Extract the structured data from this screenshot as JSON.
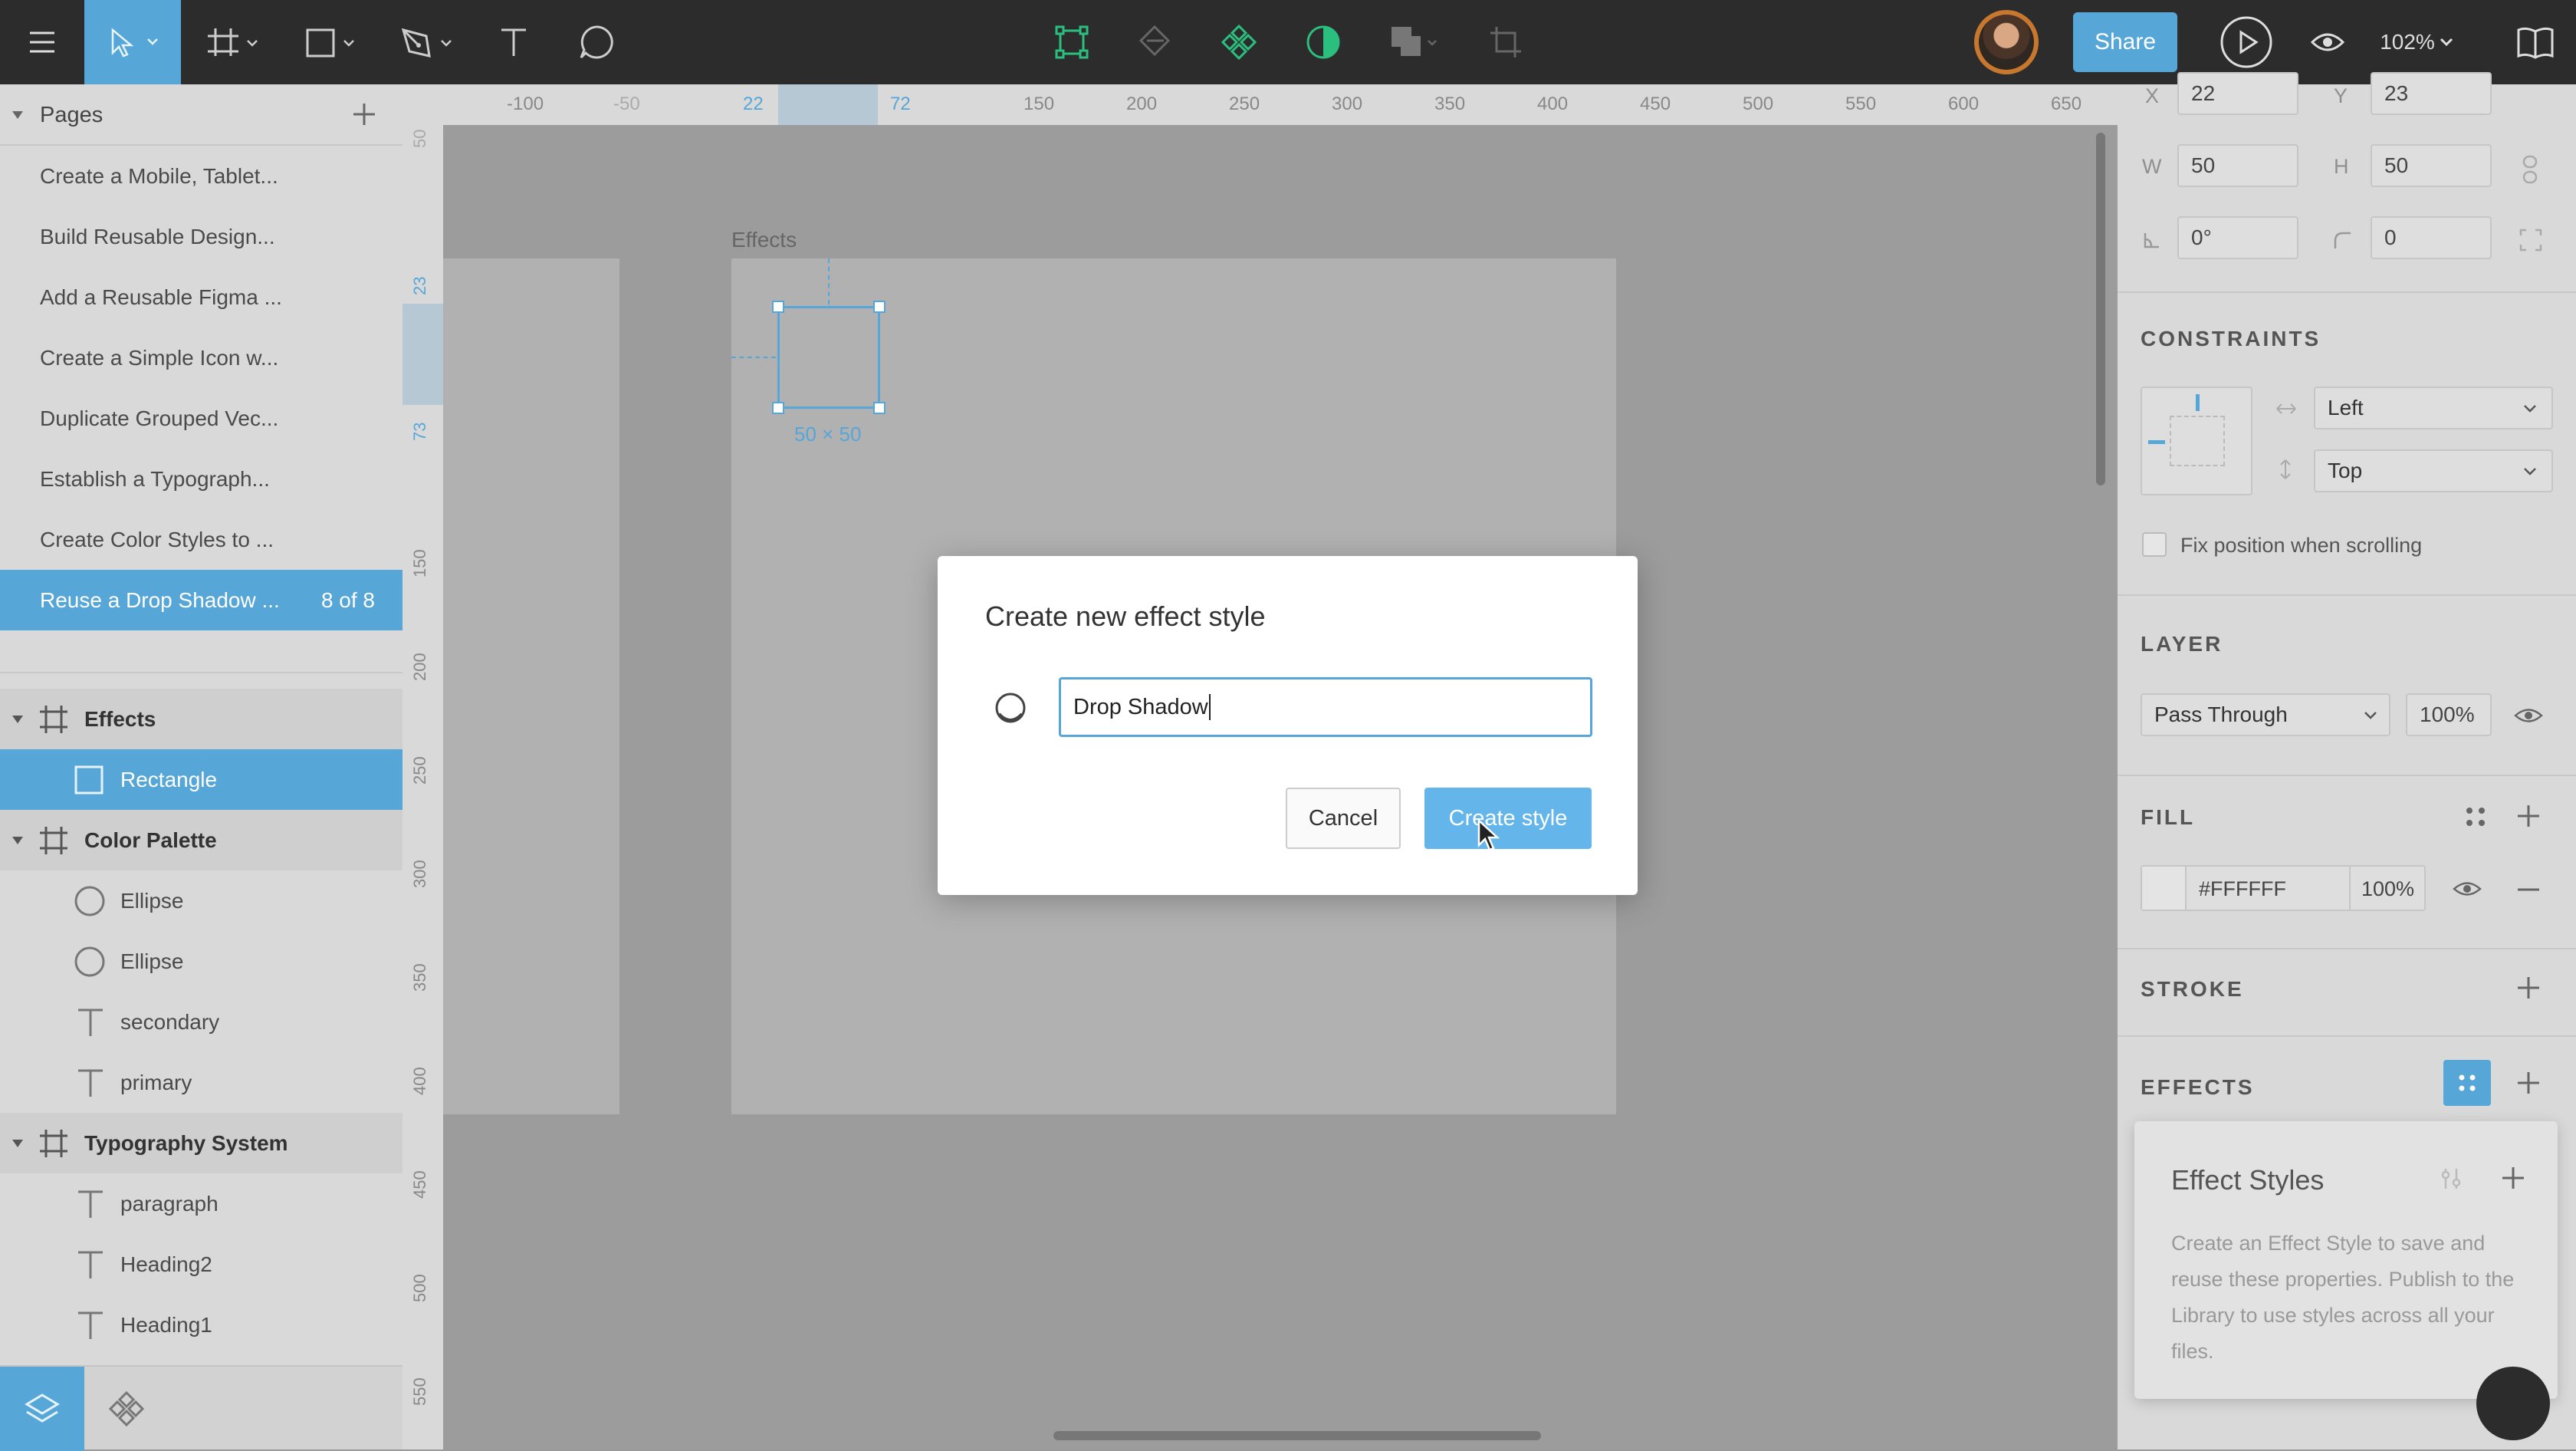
{
  "toolbar": {
    "share_label": "Share",
    "zoom": "102%",
    "icons": [
      "menu-icon",
      "move-icon",
      "frame-icon",
      "shape-icon",
      "pen-icon",
      "text-icon",
      "comment-icon",
      "component-icon",
      "boolean-icon",
      "mask-icon",
      "contrast-icon",
      "layers-boolean-icon",
      "crop-icon",
      "play-icon",
      "eye-icon",
      "book-icon"
    ]
  },
  "pages": {
    "title": "Pages",
    "items": [
      {
        "label": "Create a Mobile, Tablet..."
      },
      {
        "label": "Build Reusable Design..."
      },
      {
        "label": "Add a Reusable Figma ..."
      },
      {
        "label": "Create a Simple Icon w..."
      },
      {
        "label": "Duplicate Grouped Vec..."
      },
      {
        "label": "Establish a Typograph..."
      },
      {
        "label": "Create Color Styles to ..."
      },
      {
        "label": "Reuse a Drop Shadow ...",
        "count": "8 of 8"
      }
    ]
  },
  "layers": [
    {
      "label": "Effects",
      "kind": "frame"
    },
    {
      "label": "Rectangle",
      "kind": "rect"
    },
    {
      "label": "Color Palette",
      "kind": "frame"
    },
    {
      "label": "Ellipse",
      "kind": "ellipse"
    },
    {
      "label": "Ellipse",
      "kind": "ellipse"
    },
    {
      "label": "secondary",
      "kind": "text"
    },
    {
      "label": "primary",
      "kind": "text"
    },
    {
      "label": "Typography System",
      "kind": "frame"
    },
    {
      "label": "paragraph",
      "kind": "text"
    },
    {
      "label": "Heading2",
      "kind": "text"
    },
    {
      "label": "Heading1",
      "kind": "text"
    }
  ],
  "rulers": {
    "top": [
      "-100",
      "-50",
      "22",
      "72",
      "150",
      "200",
      "250",
      "300",
      "350",
      "400",
      "450",
      "500",
      "550",
      "600",
      "650"
    ],
    "left": [
      "50",
      "23",
      "73",
      "150",
      "200",
      "250",
      "300",
      "350",
      "400",
      "450",
      "500",
      "550"
    ]
  },
  "canvas": {
    "frame_label": "Effects",
    "size_label": "50 × 50"
  },
  "dialog": {
    "title": "Create new effect style",
    "name_value": "Drop Shadow",
    "cancel_label": "Cancel",
    "create_label": "Create style"
  },
  "inspector": {
    "x_label": "X",
    "x": "22",
    "y_label": "Y",
    "y": "23",
    "w_label": "W",
    "w": "50",
    "h_label": "H",
    "h": "50",
    "rotation": "0°",
    "radius": "0",
    "constraints_title": "CONSTRAINTS",
    "constraint_h": "Left",
    "constraint_v": "Top",
    "fix_position": "Fix position when scrolling",
    "layer_title": "LAYER",
    "blend": "Pass Through",
    "layer_opacity": "100%",
    "fill_title": "FILL",
    "fill_hex": "#FFFFFF",
    "fill_opacity": "100%",
    "stroke_title": "STROKE",
    "effects_title": "EFFECTS",
    "effect_styles_title": "Effect Styles",
    "effect_styles_desc": "Create an Effect Style to save and reuse these properties. Publish to the Library to use styles across all your files."
  },
  "colors": {
    "accent": "#56a6d8",
    "toolbar": "#2c2c2c",
    "green": "#2bbf7f"
  }
}
